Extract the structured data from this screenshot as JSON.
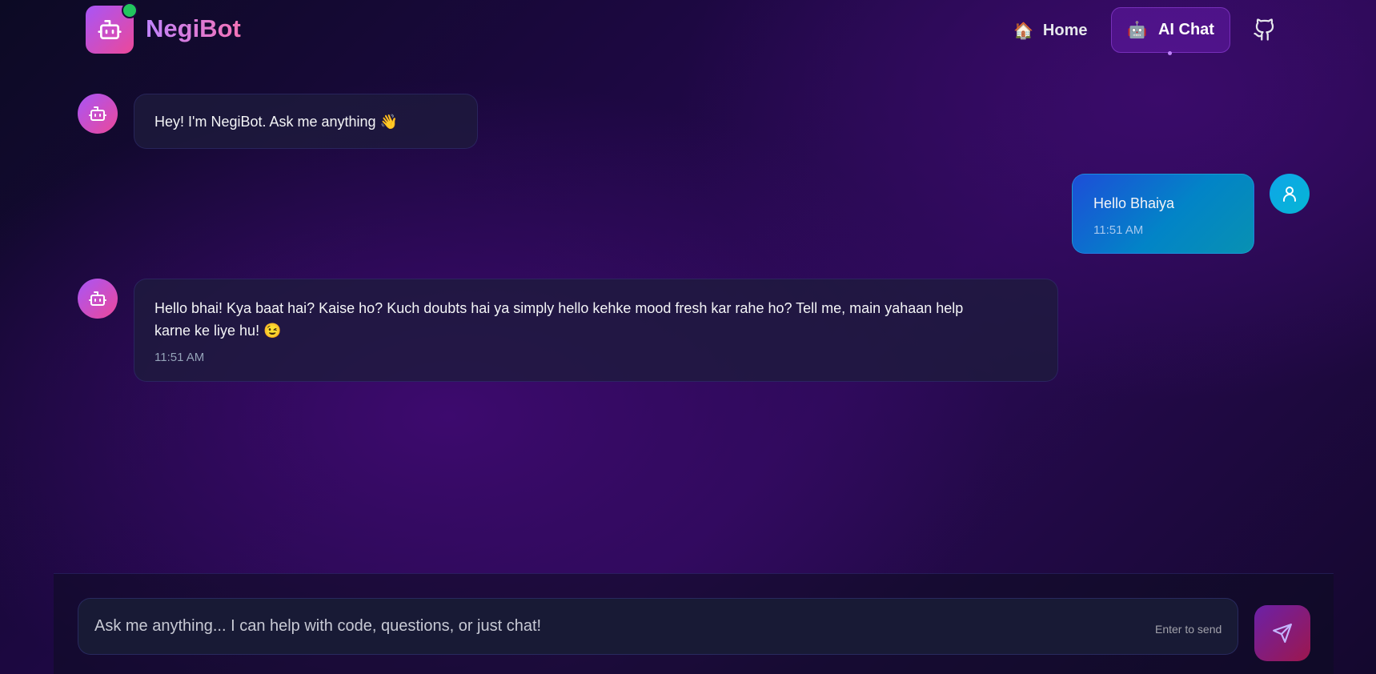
{
  "header": {
    "brand": "NegiBot",
    "nav": {
      "home": {
        "emoji": "🏠",
        "label": "Home"
      },
      "chat": {
        "emoji": "🤖",
        "label": "AI Chat"
      }
    }
  },
  "messages": [
    {
      "role": "bot",
      "text": "Hey! I'm NegiBot. Ask me anything 👋",
      "time": ""
    },
    {
      "role": "user",
      "text": "Hello Bhaiya",
      "time": "11:51 AM"
    },
    {
      "role": "bot",
      "text_line1": "Hello bhai!  Kya baat hai?  Kaise ho?  Kuch doubts hai ya simply hello kehke mood fresh kar rahe ho?  Tell me,  main yahaan help",
      "text_line2": "karne ke liye hu! 😉",
      "time": "11:51 AM"
    }
  ],
  "composer": {
    "placeholder": "Ask me anything... I can help with code, questions, or just chat!",
    "hint": "Enter to send"
  },
  "icons": {
    "logo": "bot-icon",
    "github": "github-icon",
    "user_avatar": "user-icon",
    "send": "send-icon"
  },
  "colors": {
    "accent_purple": "#a855f7",
    "accent_pink": "#ec4899",
    "online": "#22c55e",
    "user_bubble": "#1d4ed8"
  }
}
